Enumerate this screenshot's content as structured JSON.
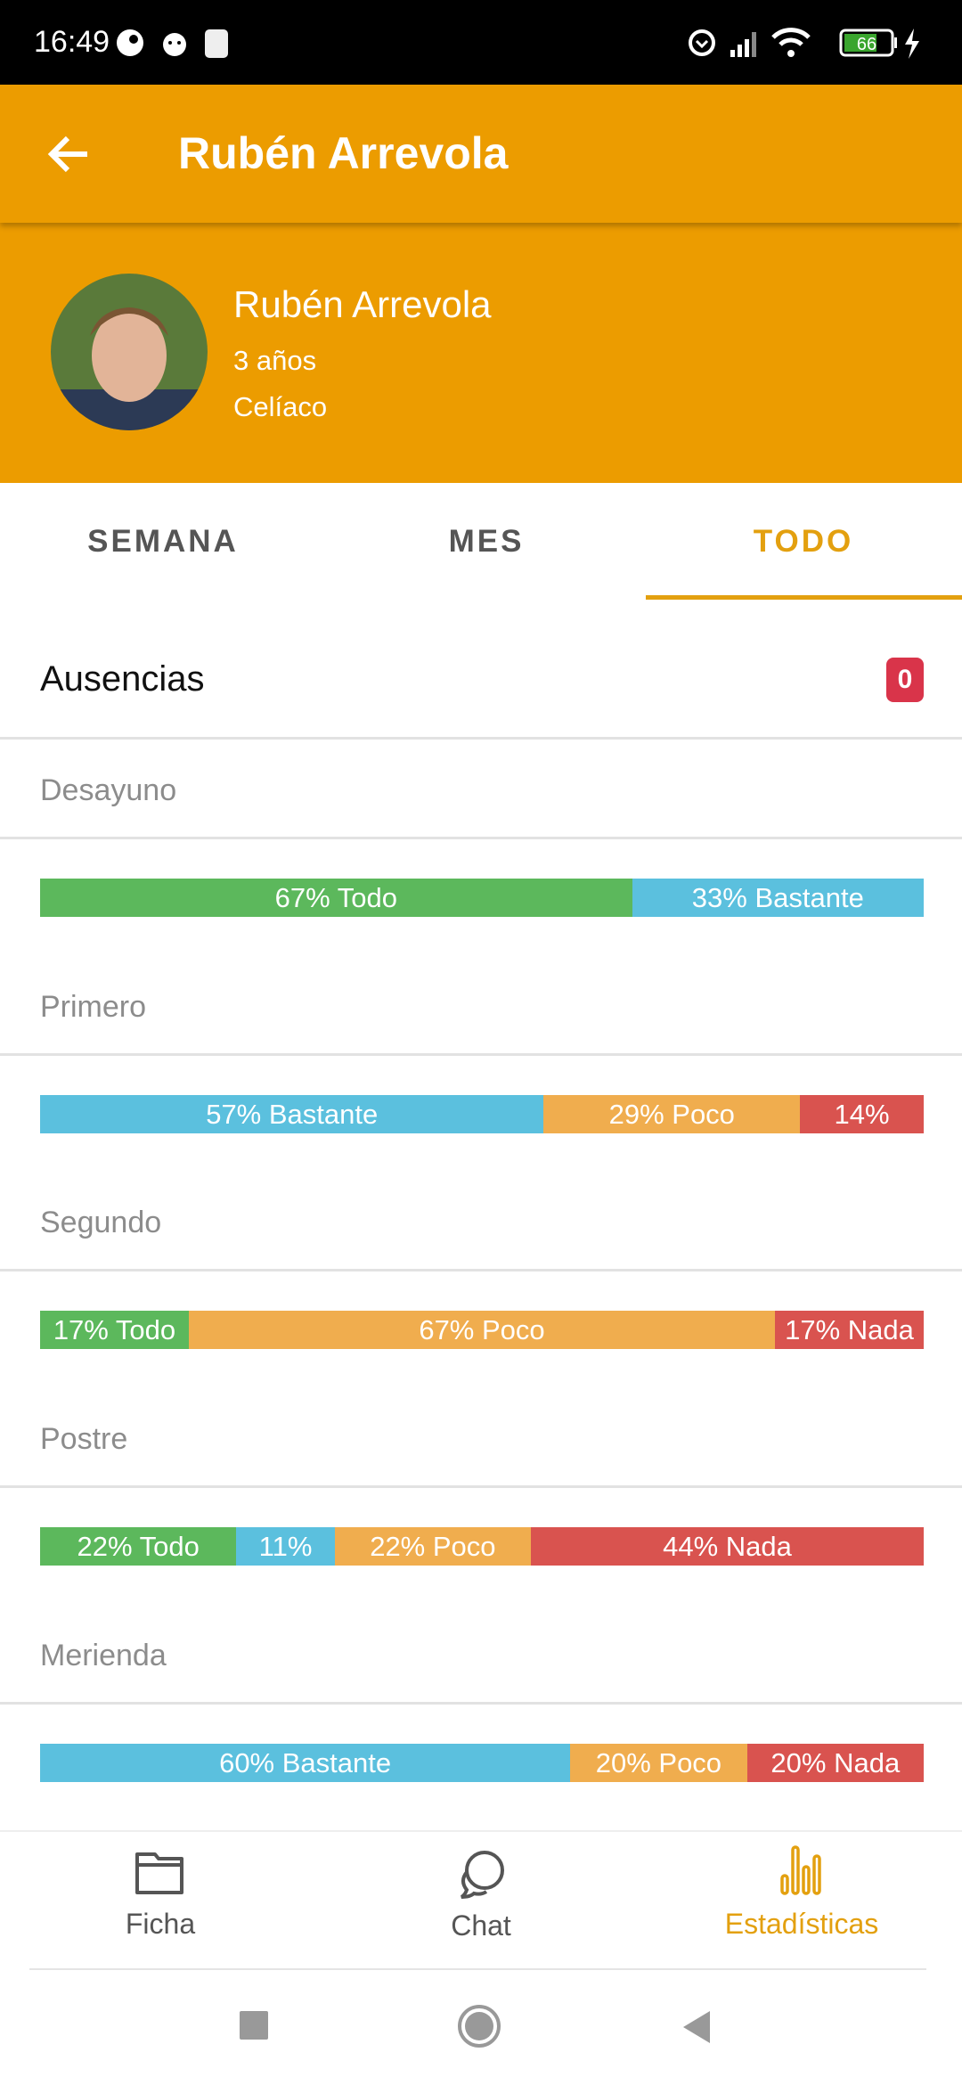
{
  "status_bar": {
    "time": "16:49",
    "battery": "66"
  },
  "app_bar": {
    "title": "Rubén Arrevola"
  },
  "profile": {
    "name": "Rubén Arrevola",
    "age": "3 años",
    "condition": "Celíaco"
  },
  "tabs": [
    {
      "label": "SEMANA"
    },
    {
      "label": "MES"
    },
    {
      "label": "TODO",
      "active": true
    }
  ],
  "absences": {
    "label": "Ausencias",
    "count": "0"
  },
  "colors": {
    "accent": "#ec9c00",
    "Todo": "#5cb85c",
    "Bastante": "#5bc0de",
    "Poco": "#f0ad4e",
    "Nada": "#d9534f"
  },
  "meals": [
    {
      "label": "Desayuno",
      "segments": [
        {
          "category": "Todo",
          "percent": 67,
          "text": "67% Todo"
        },
        {
          "category": "Bastante",
          "percent": 33,
          "text": "33% Bastante"
        }
      ]
    },
    {
      "label": "Primero",
      "segments": [
        {
          "category": "Bastante",
          "percent": 57,
          "text": "57% Bastante"
        },
        {
          "category": "Poco",
          "percent": 29,
          "text": "29% Poco"
        },
        {
          "category": "Nada",
          "percent": 14,
          "text": "14%"
        }
      ]
    },
    {
      "label": "Segundo",
      "segments": [
        {
          "category": "Todo",
          "percent": 17,
          "text": "17% Todo"
        },
        {
          "category": "Poco",
          "percent": 67,
          "text": "67% Poco"
        },
        {
          "category": "Nada",
          "percent": 17,
          "text": "17% Nada"
        }
      ]
    },
    {
      "label": "Postre",
      "segments": [
        {
          "category": "Todo",
          "percent": 22,
          "text": "22% Todo"
        },
        {
          "category": "Bastante",
          "percent": 11,
          "text": "11%"
        },
        {
          "category": "Poco",
          "percent": 22,
          "text": "22% Poco"
        },
        {
          "category": "Nada",
          "percent": 44,
          "text": "44% Nada"
        }
      ]
    },
    {
      "label": "Merienda",
      "segments": [
        {
          "category": "Bastante",
          "percent": 60,
          "text": "60% Bastante"
        },
        {
          "category": "Poco",
          "percent": 20,
          "text": "20% Poco"
        },
        {
          "category": "Nada",
          "percent": 20,
          "text": "20% Nada"
        }
      ]
    }
  ],
  "bottom_nav": [
    {
      "label": "Ficha",
      "icon": "folder-icon"
    },
    {
      "label": "Chat",
      "icon": "chat-icon"
    },
    {
      "label": "Estadísticas",
      "icon": "bar-chart-icon",
      "active": true
    }
  ]
}
